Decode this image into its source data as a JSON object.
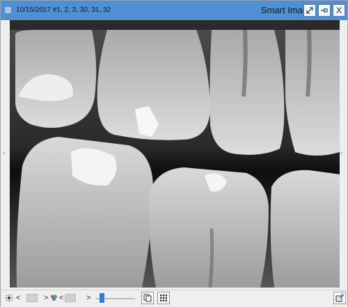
{
  "titlebar": {
    "meta": "10/15/2017 #1, 2, 3, 30, 31, 32",
    "title": "Smart Image",
    "buttons": {
      "expand_icon": "expand-icon",
      "pin_icon": "pin-icon",
      "close_label": "X"
    }
  },
  "viewer": {
    "image_description": "bitewing-xray",
    "left_arrow": "‹",
    "right_arrow": "›"
  },
  "toolbar": {
    "brightness_icon": "sun-icon",
    "brightness_prev": "<",
    "brightness_next": ">",
    "color_icon": "color-wheel-icon",
    "color_prev": "<",
    "color_next": ">",
    "slider_value": 0.15,
    "pages_icon": "pages-icon",
    "grid_icon": "grid-icon",
    "export_icon": "export-icon"
  }
}
